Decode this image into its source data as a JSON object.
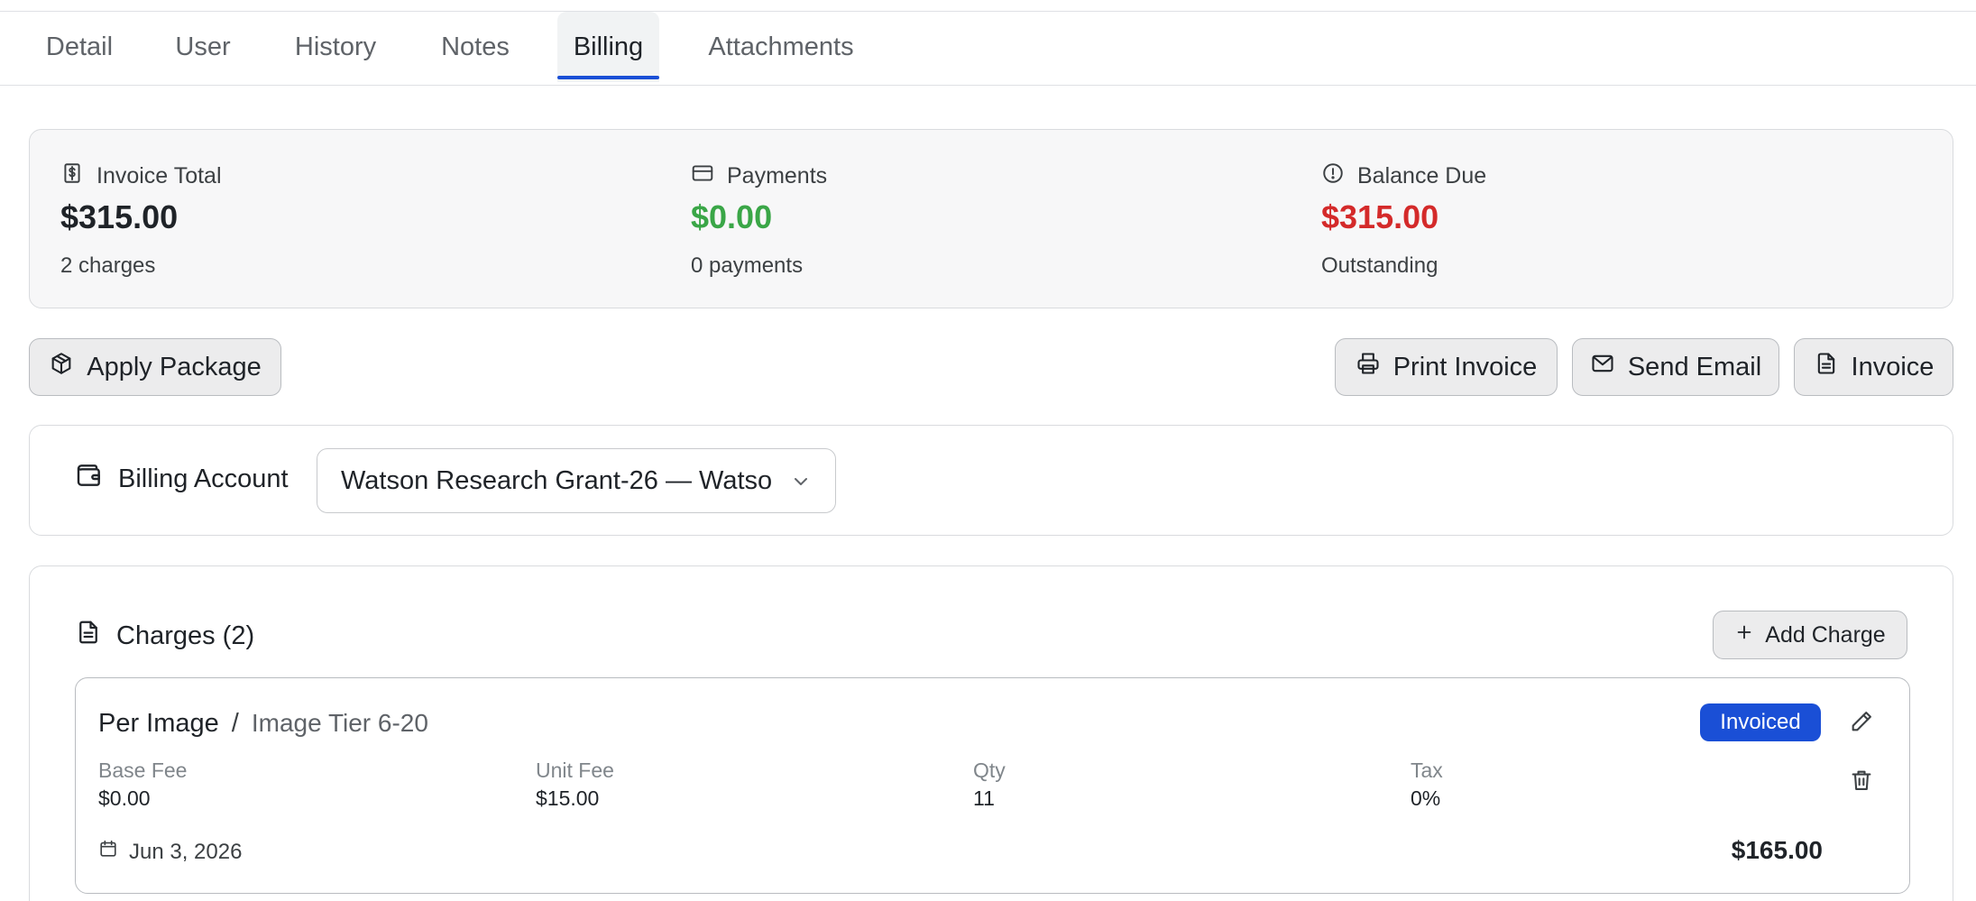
{
  "tabs": [
    {
      "label": "Detail"
    },
    {
      "label": "User"
    },
    {
      "label": "History"
    },
    {
      "label": "Notes"
    },
    {
      "label": "Billing",
      "active": true
    },
    {
      "label": "Attachments"
    }
  ],
  "summary": {
    "invoice_total": {
      "label": "Invoice Total",
      "value": "$315.00",
      "sub": "2 charges",
      "icon": "dollar-receipt-icon"
    },
    "payments": {
      "label": "Payments",
      "value": "$0.00",
      "sub": "0 payments",
      "icon": "credit-card-icon",
      "color": "#3aa647"
    },
    "balance_due": {
      "label": "Balance Due",
      "value": "$315.00",
      "sub": "Outstanding",
      "icon": "alert-circle-icon",
      "color": "#d42a2a"
    }
  },
  "actions": {
    "apply_package": "Apply Package",
    "print_invoice": "Print Invoice",
    "send_email": "Send Email",
    "invoice": "Invoice"
  },
  "billing_account": {
    "label": "Billing Account",
    "selected": "Watson Research Grant-26 — Watson"
  },
  "charges": {
    "title": "Charges (2)",
    "add_label": "Add Charge",
    "items": [
      {
        "type": "Per Image",
        "separator": "/",
        "tier": "Image Tier 6-20",
        "status": "Invoiced",
        "fields": [
          {
            "label": "Base Fee",
            "value": "$0.00"
          },
          {
            "label": "Unit Fee",
            "value": "$15.00"
          },
          {
            "label": "Qty",
            "value": "11"
          },
          {
            "label": "Tax",
            "value": "0%"
          }
        ],
        "date": "Jun 3, 2026",
        "amount": "$165.00"
      }
    ]
  },
  "colors": {
    "accent": "#1a4fd6",
    "positive": "#3aa647",
    "negative": "#d42a2a"
  }
}
